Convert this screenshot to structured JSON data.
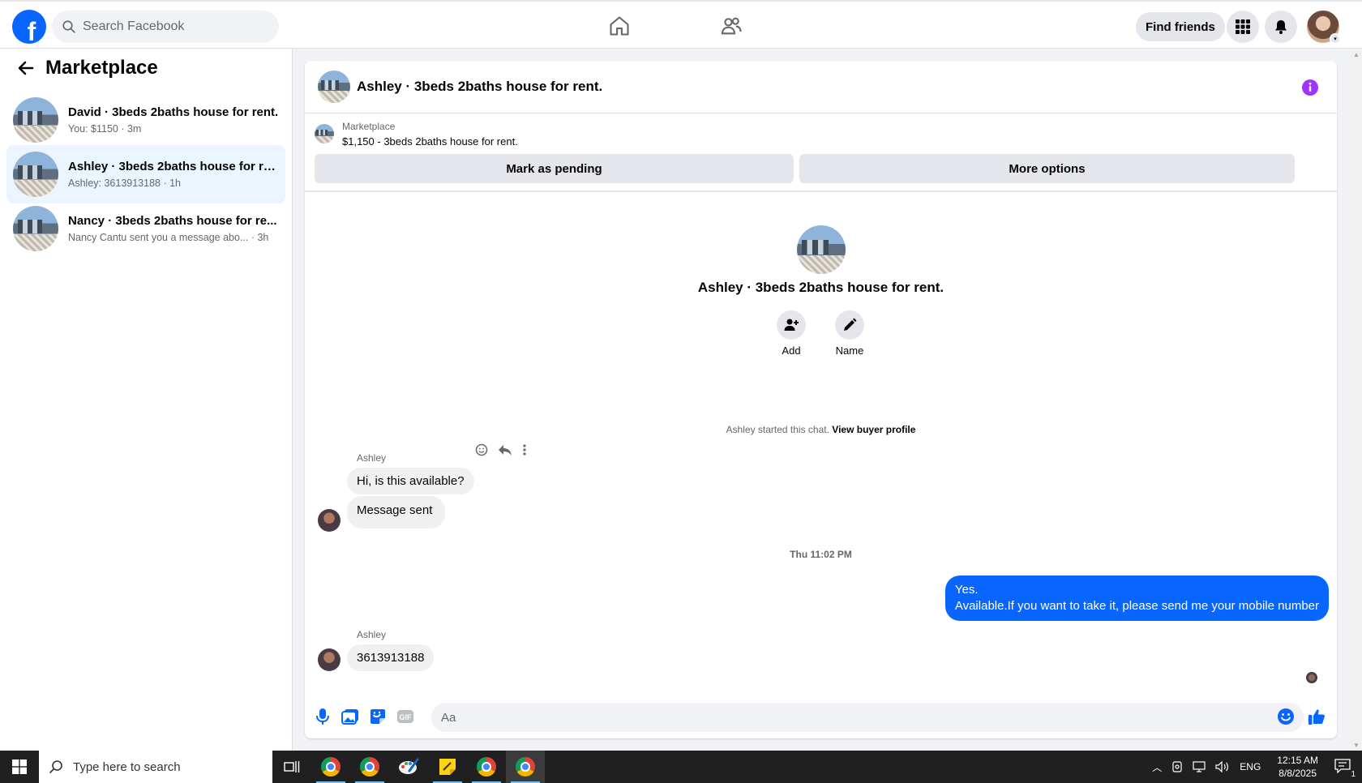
{
  "topbar": {
    "logo_letter": "f",
    "search_placeholder": "Search Facebook",
    "find_friends": "Find friends"
  },
  "sidebar": {
    "title": "Marketplace",
    "conversations": [
      {
        "name": "David · 3beds 2baths house for rent.",
        "sub": "You: $1150 · 3m",
        "active": false
      },
      {
        "name": "Ashley · 3beds 2baths house for re...",
        "sub": "Ashley: 3613913188 · 1h",
        "active": true
      },
      {
        "name": "Nancy · 3beds 2baths house for re...",
        "sub": "Nancy Cantu sent you a message abo... · 3h",
        "active": false
      }
    ]
  },
  "chat": {
    "title": "Ashley · 3beds 2baths house for rent.",
    "listing_label": "Marketplace",
    "listing_desc": "$1,150 - 3beds 2baths house for rent.",
    "mark_pending": "Mark as pending",
    "more_options": "More options",
    "center_title": "Ashley · 3beds 2baths house for rent.",
    "add_label": "Add",
    "name_label": "Name",
    "started_text": "Ashley started this chat. ",
    "view_buyer": "View buyer profile",
    "messages": [
      {
        "sender": "Ashley",
        "text": "Hi, is this available?"
      },
      {
        "text": "Message sent"
      },
      {
        "timestamp": "Thu 11:02 PM"
      },
      {
        "out_line1": "Yes.",
        "out_line2": "Available.If you want to take it, please send me your mobile number"
      },
      {
        "sender": "Ashley",
        "text": "3613913188"
      }
    ],
    "composer_placeholder": "Aa"
  },
  "taskbar": {
    "search_text": "Type here to search",
    "lang": "ENG",
    "time": "12:15 AM",
    "date": "8/8/2025",
    "notif_count": "1"
  },
  "colors": {
    "accent": "#0866ff",
    "info_purple": "#a033ff",
    "active_row": "#ebf5ff"
  }
}
